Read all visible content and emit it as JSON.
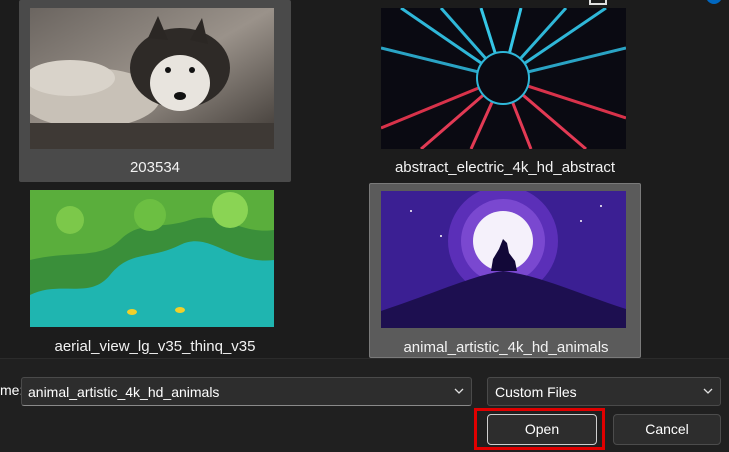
{
  "files": [
    {
      "name": "203534",
      "selected": false,
      "hovered": true
    },
    {
      "name": "abstract_electric_4k_hd_abstract",
      "selected": false,
      "hovered": false
    },
    {
      "name": "aerial_view_lg_v35_thinq_v35",
      "selected": false,
      "hovered": false
    },
    {
      "name": "animal_artistic_4k_hd_animals",
      "selected": true,
      "hovered": false
    }
  ],
  "footer": {
    "filename_label": "me:",
    "filename_value": "animal_artistic_4k_hd_animals",
    "file_type_value": "Custom Files",
    "open_label": "Open",
    "cancel_label": "Cancel"
  },
  "colors": {
    "background": "#1c1c1c",
    "highlight_outline": "#e00000",
    "accent": "#0067c0"
  },
  "icons": {
    "chevron": "chevron-down-icon",
    "window_corner": "window-icon",
    "info_dot": "info-dot-icon"
  }
}
